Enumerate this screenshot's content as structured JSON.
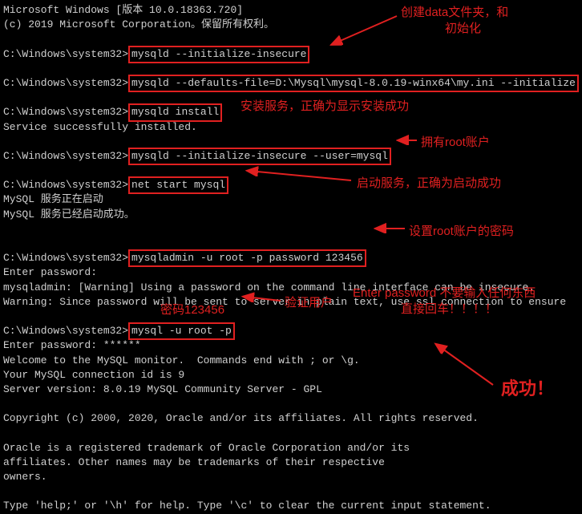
{
  "header1": "Microsoft Windows [版本 10.0.18363.720]",
  "header2": "(c) 2019 Microsoft Corporation。保留所有权利。",
  "prompt": "C:\\Windows\\system32>",
  "cmds": {
    "init_insecure": "mysqld --initialize-insecure",
    "defaults_file": "mysqld --defaults-file=D:\\Mysql\\mysql-8.0.19-winx64\\my.ini --initialize",
    "install": "mysqld install",
    "install_result": "Service successfully installed.",
    "init_user": "mysqld --initialize-insecure --user=mysql",
    "net_start": "net start mysql",
    "starting": "MySQL 服务正在启动",
    "started": "MySQL 服务已经启动成功。",
    "admin_pwd": "mysqladmin -u root -p password 123456",
    "enter_pwd": "Enter password:",
    "warn1": "mysqladmin: [Warning] Using a password on the command line interface can be insecure.",
    "warn2": "Warning: Since password will be sent to server in plain text, use ssl connection to ensure",
    "login": "mysql -u root -p",
    "enter_pwd_stars": "Enter password: ******",
    "welcome": "Welcome to the MySQL monitor.  Commands end with ; or \\g.",
    "conn_id": "Your MySQL connection id is 9",
    "server_ver": "Server version: 8.0.19 MySQL Community Server - GPL",
    "copyright": "Copyright (c) 2000, 2020, Oracle and/or its affiliates. All rights reserved.",
    "oracle1": "Oracle is a registered trademark of Oracle Corporation and/or its",
    "oracle2": "affiliates. Other names may be trademarks of their respective",
    "oracle3": "owners.",
    "help": "Type 'help;' or '\\h' for help. Type '\\c' to clear the current input statement."
  },
  "annotations": {
    "create_data": "创建data文件夹，和",
    "init": "初始化",
    "install_service": "安装服务，正确为显示安装成功",
    "root_account": "拥有root账户",
    "start_service": "启动服务，正确为启动成功",
    "set_root_pwd": "设置root账户的密码",
    "enter_pwd_note1": "Enter password 不要输入任何东西",
    "enter_pwd_note2": "直接回车！！！！",
    "pwd_123456": "密码123456",
    "verify_user": "验证用户",
    "success": "成功！"
  }
}
